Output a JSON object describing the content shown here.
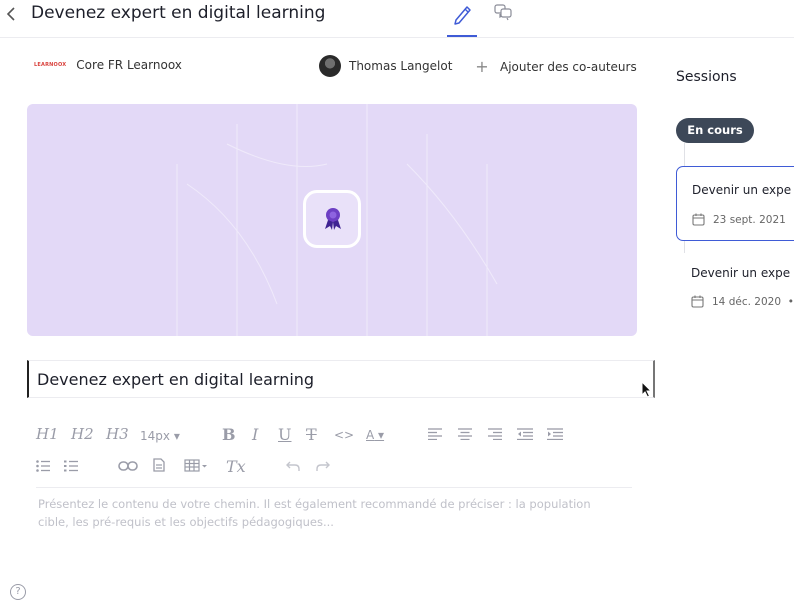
{
  "header": {
    "title": "Devenez expert en digital learning",
    "tabs": [
      {
        "name": "edit",
        "icon": "pencil-icon",
        "active": true
      },
      {
        "name": "discussion",
        "icon": "chat-bubbles-icon",
        "active": false
      }
    ]
  },
  "meta": {
    "org_logo_text": "LEARNOOX",
    "organization": "Core FR Learnoox",
    "author": "Thomas Langelot",
    "add_coauthors": "Ajouter des co-auteurs"
  },
  "cover": {
    "icon": "award-ribbon-icon",
    "background": "#e3d9f7"
  },
  "editor": {
    "title_value": "Devenez expert en digital learning",
    "toolbar": {
      "h1": "H1",
      "h2": "H2",
      "h3": "H3",
      "font_size": "14px",
      "bold": "B",
      "italic": "I",
      "underline": "U",
      "strike": "T",
      "code": "<>",
      "text_color": "A",
      "clear_format": "Tx"
    },
    "description_placeholder": "Présentez le contenu de votre chemin. Il est également recommandé de préciser : la population cible, les pré-requis et les objectifs pédagogiques..."
  },
  "help": {
    "label": "?"
  },
  "sessions": {
    "title": "Sessions",
    "status": "En cours",
    "items": [
      {
        "title": "Devenir un expe",
        "date": "23 sept. 2021",
        "sep": "•",
        "active": true
      },
      {
        "title": "Devenir un expe",
        "date": "14 déc. 2020",
        "sep": "•",
        "active": false
      }
    ]
  },
  "colors": {
    "accent": "#3f5bd6",
    "chip": "#3d4858",
    "cover": "#e3d9f7",
    "badge": "#6d3fc4"
  }
}
